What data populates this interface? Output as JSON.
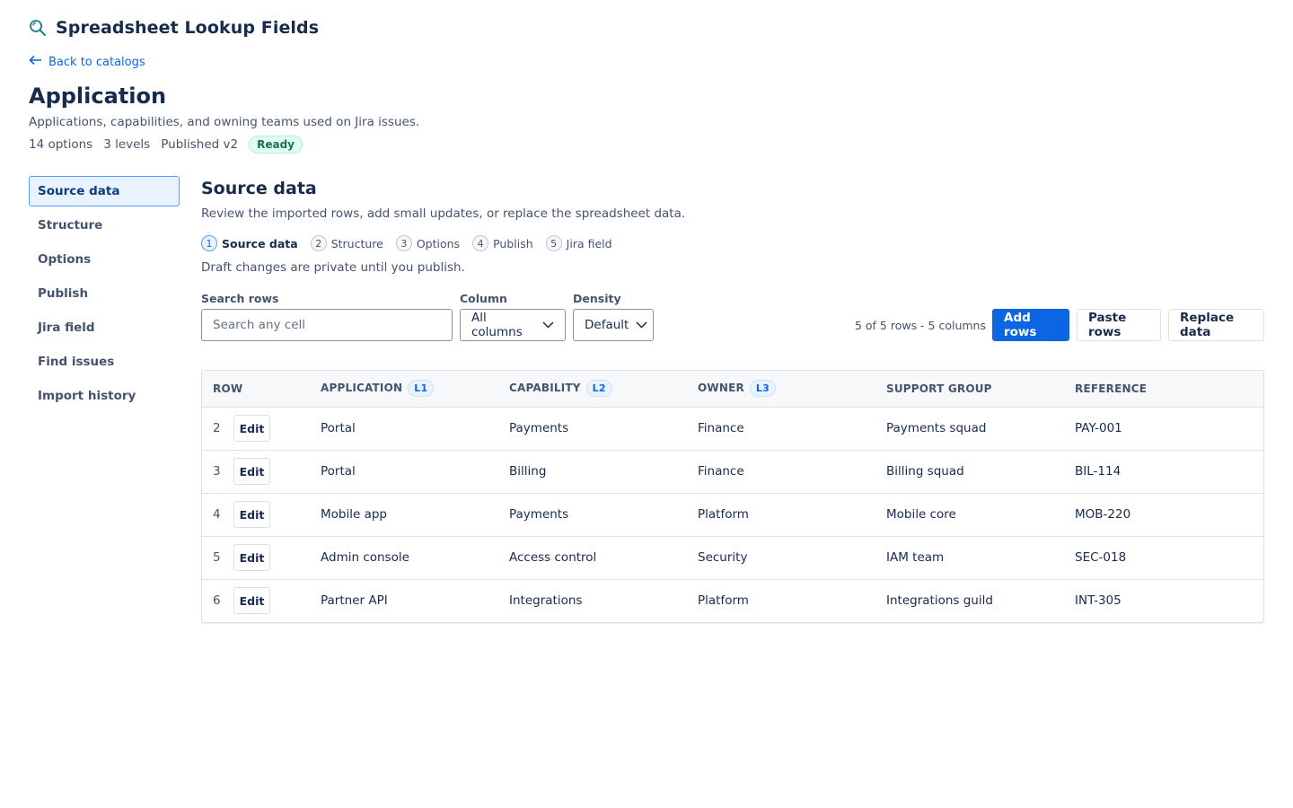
{
  "app": {
    "title": "Spreadsheet Lookup Fields",
    "icon": "search-icon"
  },
  "back_link": {
    "label": "Back to catalogs",
    "icon": "arrow-left-icon"
  },
  "catalog": {
    "title": "Application",
    "description": "Applications, capabilities, and owning teams used on Jira issues.",
    "options": "14 options",
    "levels": "3 levels",
    "published": "Published v2",
    "status": "Ready"
  },
  "sidebar": {
    "items": [
      {
        "label": "Source data",
        "active": true
      },
      {
        "label": "Structure"
      },
      {
        "label": "Options"
      },
      {
        "label": "Publish"
      },
      {
        "label": "Jira field"
      },
      {
        "label": "Find issues"
      },
      {
        "label": "Import history"
      }
    ]
  },
  "section": {
    "title": "Source data",
    "description": "Review the imported rows, add small updates, or replace the spreadsheet data.",
    "draft_note": "Draft changes are private until you publish."
  },
  "steps": [
    {
      "num": "1",
      "label": "Source data",
      "active": true
    },
    {
      "num": "2",
      "label": "Structure"
    },
    {
      "num": "3",
      "label": "Options"
    },
    {
      "num": "4",
      "label": "Publish"
    },
    {
      "num": "5",
      "label": "Jira field"
    }
  ],
  "controls": {
    "search_label": "Search rows",
    "search_placeholder": "Search any cell",
    "search_value": "",
    "column_label": "Column",
    "column_value": "All columns",
    "density_label": "Density",
    "density_value": "Default",
    "row_count": "5 of 5 rows - 5 columns",
    "add_rows": "Add rows",
    "paste_rows": "Paste rows",
    "replace_data": "Replace data"
  },
  "table": {
    "headers": {
      "row": "ROW",
      "application": "APPLICATION",
      "application_level": "L1",
      "capability": "CAPABILITY",
      "capability_level": "L2",
      "owner": "OWNER",
      "owner_level": "L3",
      "support_group": "SUPPORT GROUP",
      "reference": "REFERENCE"
    },
    "edit_label": "Edit",
    "rows": [
      {
        "row": "2",
        "application": "Portal",
        "capability": "Payments",
        "owner": "Finance",
        "support_group": "Payments squad",
        "reference": "PAY-001"
      },
      {
        "row": "3",
        "application": "Portal",
        "capability": "Billing",
        "owner": "Finance",
        "support_group": "Billing squad",
        "reference": "BIL-114"
      },
      {
        "row": "4",
        "application": "Mobile app",
        "capability": "Payments",
        "owner": "Platform",
        "support_group": "Mobile core",
        "reference": "MOB-220"
      },
      {
        "row": "5",
        "application": "Admin console",
        "capability": "Access control",
        "owner": "Security",
        "support_group": "IAM team",
        "reference": "SEC-018"
      },
      {
        "row": "6",
        "application": "Partner API",
        "capability": "Integrations",
        "owner": "Platform",
        "support_group": "Integrations guild",
        "reference": "INT-305"
      }
    ]
  },
  "colors": {
    "primary": "#0c66e4",
    "text": "#172b4d",
    "subtle": "#44546f",
    "success_bg": "#dcfff1",
    "success_text": "#216e4e"
  }
}
